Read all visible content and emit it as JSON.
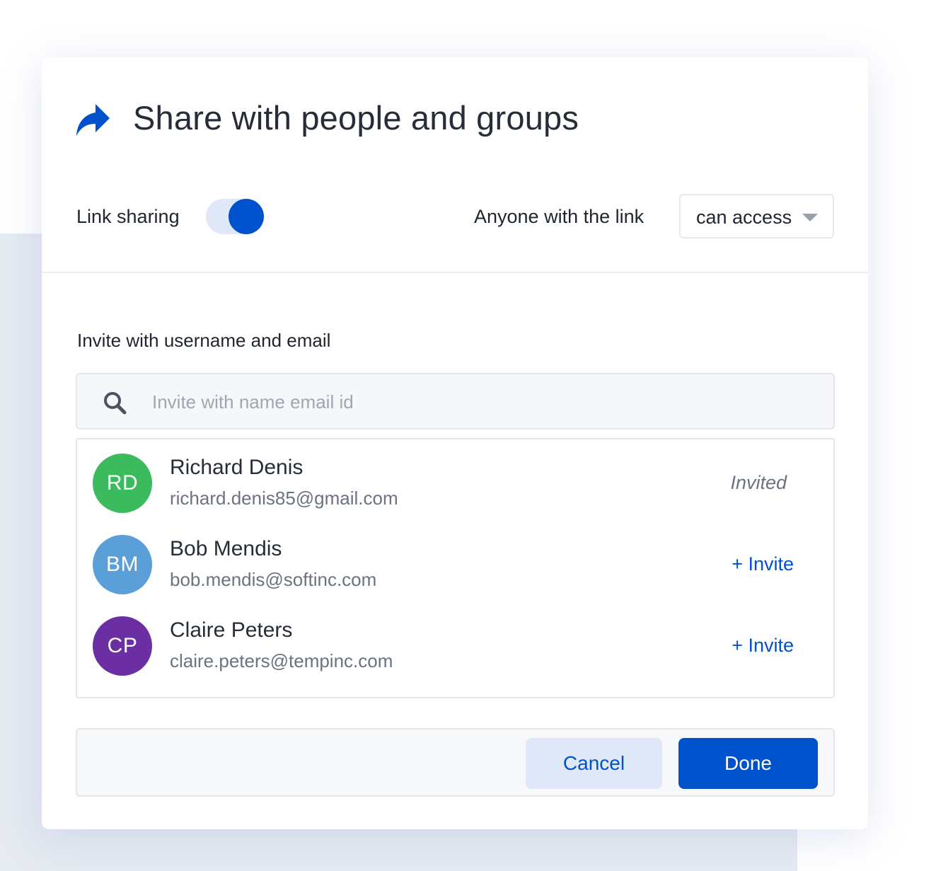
{
  "dialog": {
    "title": "Share with people and groups",
    "title_icon": "share-arrow-icon"
  },
  "link_sharing": {
    "label": "Link sharing",
    "enabled": true,
    "audience_label": "Anyone with the link",
    "access_value": "can access"
  },
  "invite": {
    "heading": "Invite with username and email",
    "search_placeholder": "Invite with name email id",
    "search_value": ""
  },
  "people": [
    {
      "initials": "RD",
      "name": "Richard Denis",
      "email": "richard.denis85@gmail.com",
      "action": "Invited",
      "avatar_color": "#3cba5e"
    },
    {
      "initials": "BM",
      "name": "Bob Mendis",
      "email": "bob.mendis@softinc.com",
      "action": "+ Invite",
      "avatar_color": "#5b9fd8"
    },
    {
      "initials": "CP",
      "name": "Claire Peters",
      "email": "claire.peters@tempinc.com",
      "action": "+ Invite",
      "avatar_color": "#6b2fa3"
    }
  ],
  "footer": {
    "cancel_label": "Cancel",
    "done_label": "Done"
  },
  "colors": {
    "accent": "#0052cc",
    "accent_light": "#dfe8f7"
  }
}
